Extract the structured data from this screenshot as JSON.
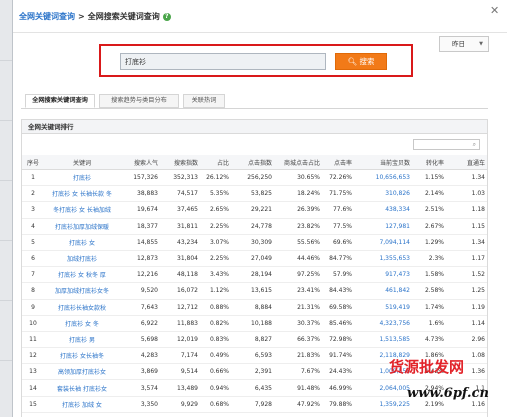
{
  "breadcrumb": {
    "root": "全网关键词查询",
    "separator": ">",
    "current": "全网搜索关键词查询"
  },
  "help_icon": "question-circle-icon",
  "close_icon": "close-icon",
  "date_select": {
    "value": "昨日"
  },
  "search": {
    "value": "打底衫",
    "button_label": "搜索"
  },
  "tabs": [
    "全网搜索关键词查询",
    "搜索趋势与类目分布",
    "关联热词"
  ],
  "panel_title": "全网关键词排行",
  "table": {
    "headers": [
      "序号",
      "关键词",
      "搜索人气",
      "搜索指数",
      "占比",
      "点击指数",
      "商城点击占比",
      "点击率",
      "当前宝贝数",
      "转化率",
      "直通车"
    ],
    "rows": [
      [
        "1",
        "打底衫",
        "157,326",
        "352,313",
        "26.12%",
        "256,250",
        "30.65%",
        "72.26%",
        "10,656,653",
        "1.15%",
        "1.34"
      ],
      [
        "2",
        "打底衫 女 长袖长款 冬",
        "38,883",
        "74,517",
        "5.35%",
        "53,825",
        "18.24%",
        "71.75%",
        "310,826",
        "2.14%",
        "1.03"
      ],
      [
        "3",
        "冬打底衫 女 长袖加绒",
        "19,674",
        "37,465",
        "2.65%",
        "29,221",
        "26.39%",
        "77.6%",
        "438,334",
        "2.51%",
        "1.18"
      ],
      [
        "4",
        "打底衫加厚加绒保暖",
        "18,377",
        "31,811",
        "2.25%",
        "24,778",
        "23.82%",
        "77.5%",
        "127,981",
        "2.67%",
        "1.15"
      ],
      [
        "5",
        "打底衫 女",
        "14,855",
        "43,234",
        "3.07%",
        "30,309",
        "55.56%",
        "69.6%",
        "7,094,114",
        "1.29%",
        "1.34"
      ],
      [
        "6",
        "加绒打底衫",
        "12,873",
        "31,804",
        "2.25%",
        "27,049",
        "44.46%",
        "84.77%",
        "1,355,653",
        "2.3%",
        "1.17"
      ],
      [
        "7",
        "打底衫 女 秋冬 厚",
        "12,216",
        "48,118",
        "3.43%",
        "28,194",
        "97.25%",
        "57.9%",
        "917,473",
        "1.58%",
        "1.52"
      ],
      [
        "8",
        "加厚加绒打底衫女冬",
        "9,520",
        "16,072",
        "1.12%",
        "13,615",
        "23.41%",
        "84.43%",
        "461,842",
        "2.58%",
        "1.25"
      ],
      [
        "9",
        "打底衫长袖女款秋",
        "7,643",
        "12,712",
        "0.88%",
        "8,884",
        "21.31%",
        "69.58%",
        "519,419",
        "1.74%",
        "1.19"
      ],
      [
        "10",
        "打底衫 女 冬",
        "6,922",
        "11,883",
        "0.82%",
        "10,188",
        "30.37%",
        "85.46%",
        "4,323,756",
        "1.6%",
        "1.14"
      ],
      [
        "11",
        "打底衫 男",
        "5,698",
        "12,019",
        "0.83%",
        "8,827",
        "66.37%",
        "72.98%",
        "1,513,585",
        "4.73%",
        "2.96"
      ],
      [
        "12",
        "打底衫 女长袖冬",
        "4,283",
        "7,174",
        "0.49%",
        "6,593",
        "21.83%",
        "91.74%",
        "2,118,829",
        "1.86%",
        "1.08"
      ],
      [
        "13",
        "高领加厚打底衫女",
        "3,869",
        "9,514",
        "0.66%",
        "2,391",
        "7.67%",
        "24.43%",
        "1,009,556",
        "1.43%",
        "1.36"
      ],
      [
        "14",
        "套装长袖 打底衫女",
        "3,574",
        "13,489",
        "0.94%",
        "6,435",
        "91.48%",
        "46.99%",
        "2,064,005",
        "2.94%",
        "1.1"
      ],
      [
        "15",
        "打底衫 加绒 女",
        "3,350",
        "9,929",
        "0.68%",
        "7,928",
        "47.92%",
        "79.88%",
        "1,359,225",
        "2.19%",
        "1.16"
      ]
    ]
  },
  "watermark": {
    "text": "货源批发网",
    "url": "www.6pf.cn"
  },
  "colors": {
    "accent_orange": "#f27a18",
    "highlight_red": "#d9191a",
    "link_blue": "#2a73c9"
  }
}
